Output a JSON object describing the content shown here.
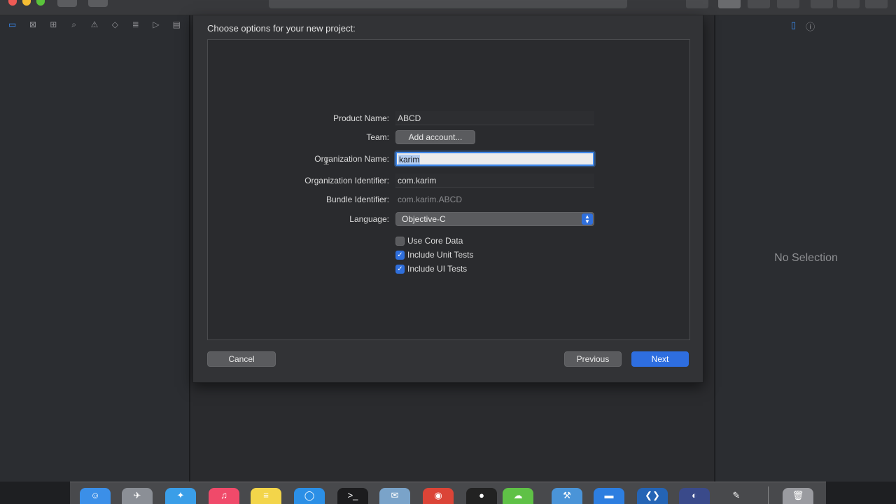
{
  "sheet": {
    "title": "Choose options for your new project:",
    "fields": {
      "product_name": {
        "label": "Product Name:",
        "value": "ABCD"
      },
      "team": {
        "label": "Team:",
        "button": "Add account..."
      },
      "organization_name": {
        "label": "Organization Name:",
        "value": "karim"
      },
      "organization_identifier": {
        "label": "Organization Identifier:",
        "value": "com.karim"
      },
      "bundle_identifier": {
        "label": "Bundle Identifier:",
        "value": "com.karim.ABCD"
      },
      "language": {
        "label": "Language:",
        "value": "Objective-C"
      }
    },
    "checkboxes": [
      {
        "label": "Use Core Data",
        "checked": false
      },
      {
        "label": "Include Unit Tests",
        "checked": true
      },
      {
        "label": "Include UI Tests",
        "checked": true
      }
    ],
    "buttons": {
      "cancel": "Cancel",
      "previous": "Previous",
      "next": "Next"
    }
  },
  "inspector": {
    "empty_text": "No Selection"
  },
  "colors": {
    "accent": "#2e6ee0",
    "focus_ring": "#3d86e8",
    "background": "#1e1f22"
  },
  "icons": {
    "navigator": [
      "folder-icon",
      "source-control-icon",
      "hierarchy-icon",
      "search-icon",
      "warning-icon",
      "test-icon",
      "debug-icon",
      "breakpoint-icon",
      "report-icon"
    ],
    "inspector": [
      "file-inspector-icon",
      "help-icon"
    ]
  }
}
